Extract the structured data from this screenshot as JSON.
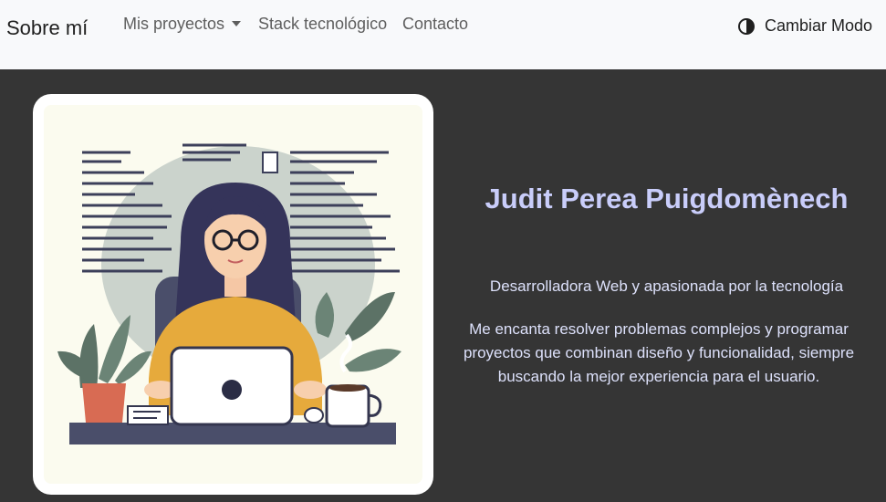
{
  "navbar": {
    "brand": "Sobre mí",
    "links": [
      {
        "label": "Mis proyectos",
        "has_dropdown": true
      },
      {
        "label": "Stack tecnológico"
      },
      {
        "label": "Contacto"
      }
    ],
    "mode_toggle": {
      "label": "Cambiar Modo",
      "icon": "contrast-icon"
    }
  },
  "hero": {
    "illustration": "developer-woman-with-laptop",
    "name": "Judit Perea Puigdomènech",
    "tagline": "Desarrolladora Web y apasionada por la tecnología",
    "description": "Me encanta resolver problemas complejos y programar proyectos que combinan diseño y funcionalidad, siempre buscando la mejor experiencia para el usuario."
  },
  "colors": {
    "navbar_bg": "#f8f9fb",
    "page_bg": "#353535",
    "name_text": "#c9cdfa",
    "body_text": "#dde1fb"
  }
}
